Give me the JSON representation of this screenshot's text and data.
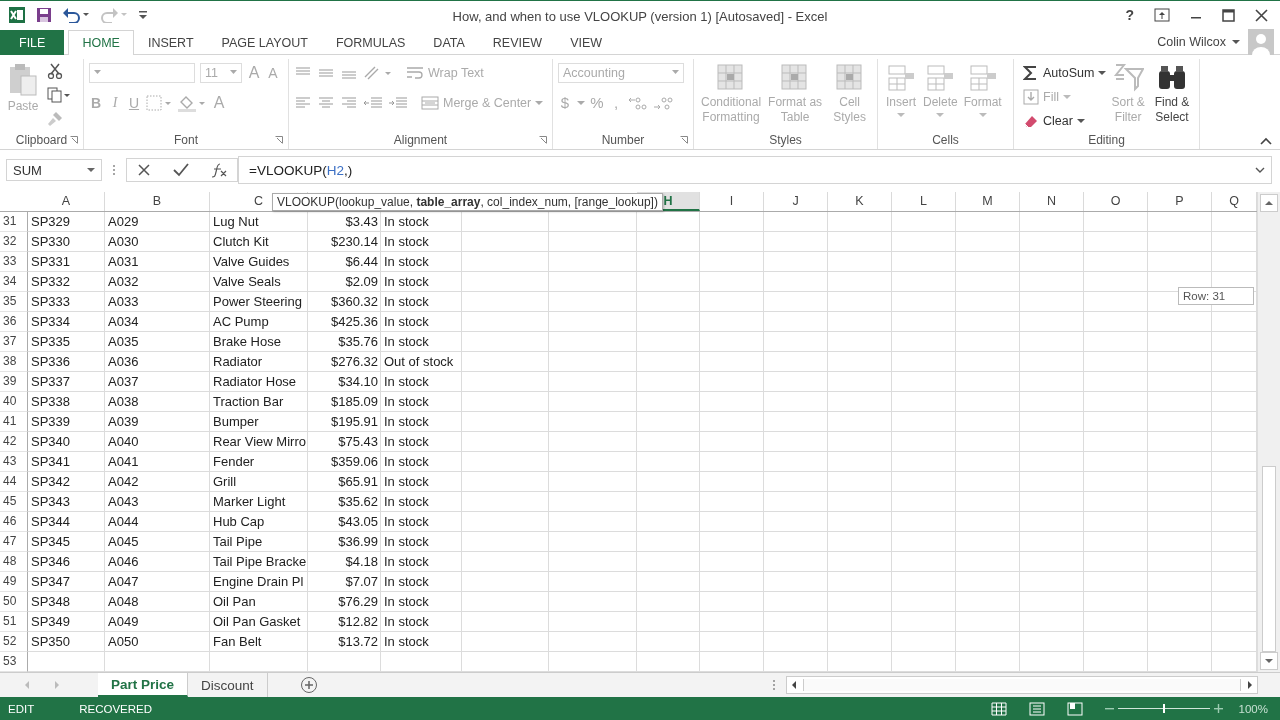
{
  "title_bar": {
    "title": "How, and when to use VLOOKUP (version 1) [Autosaved] - Excel",
    "help": "?",
    "redo_disabled": true
  },
  "tabs": [
    {
      "label": "FILE",
      "kind": "file",
      "selected": false
    },
    {
      "label": "HOME",
      "kind": "tab",
      "selected": true
    },
    {
      "label": "INSERT",
      "kind": "tab",
      "selected": false
    },
    {
      "label": "PAGE LAYOUT",
      "kind": "tab",
      "selected": false
    },
    {
      "label": "FORMULAS",
      "kind": "tab",
      "selected": false
    },
    {
      "label": "DATA",
      "kind": "tab",
      "selected": false
    },
    {
      "label": "REVIEW",
      "kind": "tab",
      "selected": false
    },
    {
      "label": "VIEW",
      "kind": "tab",
      "selected": false
    }
  ],
  "user": {
    "name": "Colin Wilcox"
  },
  "ribbon": {
    "clipboard": {
      "label": "Clipboard",
      "paste": {
        "label": "Paste",
        "disabled": true
      }
    },
    "font": {
      "label": "Font",
      "font_size": "11",
      "grow": "A",
      "shrink": "A",
      "bold": "B",
      "italic": "I",
      "underline": "U",
      "font_color": "A"
    },
    "alignment": {
      "label": "Alignment",
      "wrap_text": "Wrap Text",
      "merge_center": "Merge & Center"
    },
    "number": {
      "label": "Number",
      "format": "Accounting",
      "currency": "$",
      "percent": "%",
      "comma": ","
    },
    "styles": {
      "label": "Styles",
      "buttons": [
        {
          "label": "Conditional Formatting",
          "disabled": true
        },
        {
          "label": "Format as Table",
          "disabled": true
        },
        {
          "label": "Cell Styles",
          "disabled": true
        }
      ]
    },
    "cells": {
      "label": "Cells",
      "buttons": [
        {
          "label": "Insert",
          "disabled": true
        },
        {
          "label": "Delete",
          "disabled": true
        },
        {
          "label": "Format",
          "disabled": true
        }
      ]
    },
    "editing": {
      "label": "Editing",
      "small_buttons": [
        {
          "label": "AutoSum",
          "disabled": false
        },
        {
          "label": "Fill",
          "disabled": true
        },
        {
          "label": "Clear",
          "disabled": false
        }
      ],
      "large_buttons": [
        {
          "label": "Sort & Filter",
          "disabled": true
        },
        {
          "label": "Find & Select",
          "disabled": false
        }
      ]
    }
  },
  "formula_bar": {
    "name_box": "SUM",
    "formula": [
      {
        "text": "=VLOOKUP(",
        "kind": "plain"
      },
      {
        "text": "H2",
        "kind": "reference"
      },
      {
        "text": ",)",
        "kind": "plain"
      }
    ]
  },
  "tooltip": "VLOOKUP(lookup_value, **table_array**, col_index_num, [range_lookup])",
  "row_tooltip": "Row: 31",
  "columns": [
    {
      "label": "A",
      "selected": false
    },
    {
      "label": "B",
      "selected": false
    },
    {
      "label": "C",
      "selected": false
    },
    {
      "label": "H",
      "selected": true
    },
    {
      "label": "I",
      "selected": false
    },
    {
      "label": "J",
      "selected": false
    },
    {
      "label": "K",
      "selected": false
    },
    {
      "label": "L",
      "selected": false
    },
    {
      "label": "M",
      "selected": false
    },
    {
      "label": "N",
      "selected": false
    },
    {
      "label": "O",
      "selected": false
    },
    {
      "label": "P",
      "selected": false
    },
    {
      "label": "Q",
      "selected": false
    }
  ],
  "rows": [
    {
      "number": "31",
      "cells": [
        "SP329",
        "A029",
        "Lug Nut",
        "$3.43",
        "In stock"
      ]
    },
    {
      "number": "32",
      "cells": [
        "SP330",
        "A030",
        "Clutch Kit",
        "$230.14",
        "In stock"
      ]
    },
    {
      "number": "33",
      "cells": [
        "SP331",
        "A031",
        "Valve Guides",
        "$6.44",
        "In stock"
      ]
    },
    {
      "number": "34",
      "cells": [
        "SP332",
        "A032",
        "Valve Seals",
        "$2.09",
        "In stock"
      ]
    },
    {
      "number": "35",
      "cells": [
        "SP333",
        "A033",
        "Power Steering",
        "$360.32",
        "In stock"
      ]
    },
    {
      "number": "36",
      "cells": [
        "SP334",
        "A034",
        "AC Pump",
        "$425.36",
        "In stock"
      ]
    },
    {
      "number": "37",
      "cells": [
        "SP335",
        "A035",
        "Brake Hose",
        "$35.76",
        "In stock"
      ]
    },
    {
      "number": "38",
      "cells": [
        "SP336",
        "A036",
        "Radiator",
        "$276.32",
        "Out of stock"
      ]
    },
    {
      "number": "39",
      "cells": [
        "SP337",
        "A037",
        "Radiator Hose",
        "$34.10",
        "In stock"
      ]
    },
    {
      "number": "40",
      "cells": [
        "SP338",
        "A038",
        "Traction Bar",
        "$185.09",
        "In stock"
      ]
    },
    {
      "number": "41",
      "cells": [
        "SP339",
        "A039",
        "Bumper",
        "$195.91",
        "In stock"
      ]
    },
    {
      "number": "42",
      "cells": [
        "SP340",
        "A040",
        "Rear View Mirro",
        "$75.43",
        "In stock"
      ]
    },
    {
      "number": "43",
      "cells": [
        "SP341",
        "A041",
        "Fender",
        "$359.06",
        "In stock"
      ]
    },
    {
      "number": "44",
      "cells": [
        "SP342",
        "A042",
        "Grill",
        "$65.91",
        "In stock"
      ]
    },
    {
      "number": "45",
      "cells": [
        "SP343",
        "A043",
        "Marker Light",
        "$35.62",
        "In stock"
      ]
    },
    {
      "number": "46",
      "cells": [
        "SP344",
        "A044",
        "Hub Cap",
        "$43.05",
        "In stock"
      ]
    },
    {
      "number": "47",
      "cells": [
        "SP345",
        "A045",
        "Tail Pipe",
        "$36.99",
        "In stock"
      ]
    },
    {
      "number": "48",
      "cells": [
        "SP346",
        "A046",
        "Tail Pipe Bracke",
        "$4.18",
        "In stock"
      ]
    },
    {
      "number": "49",
      "cells": [
        "SP347",
        "A047",
        "Engine Drain Pl",
        "$7.07",
        "In stock"
      ]
    },
    {
      "number": "50",
      "cells": [
        "SP348",
        "A048",
        "Oil Pan",
        "$76.29",
        "In stock"
      ]
    },
    {
      "number": "51",
      "cells": [
        "SP349",
        "A049",
        "Oil Pan Gasket",
        "$12.82",
        "In stock"
      ]
    },
    {
      "number": "52",
      "cells": [
        "SP350",
        "A050",
        "Fan Belt",
        "$13.72",
        "In stock"
      ]
    },
    {
      "number": "53"
    }
  ],
  "sheets": [
    {
      "label": "Part Price",
      "selected": true
    },
    {
      "label": "Discount",
      "selected": false
    }
  ],
  "status_bar": {
    "mode": "EDIT",
    "state": "RECOVERED",
    "zoom": "100%",
    "zoom_slider": {
      "level": 0.5
    }
  }
}
